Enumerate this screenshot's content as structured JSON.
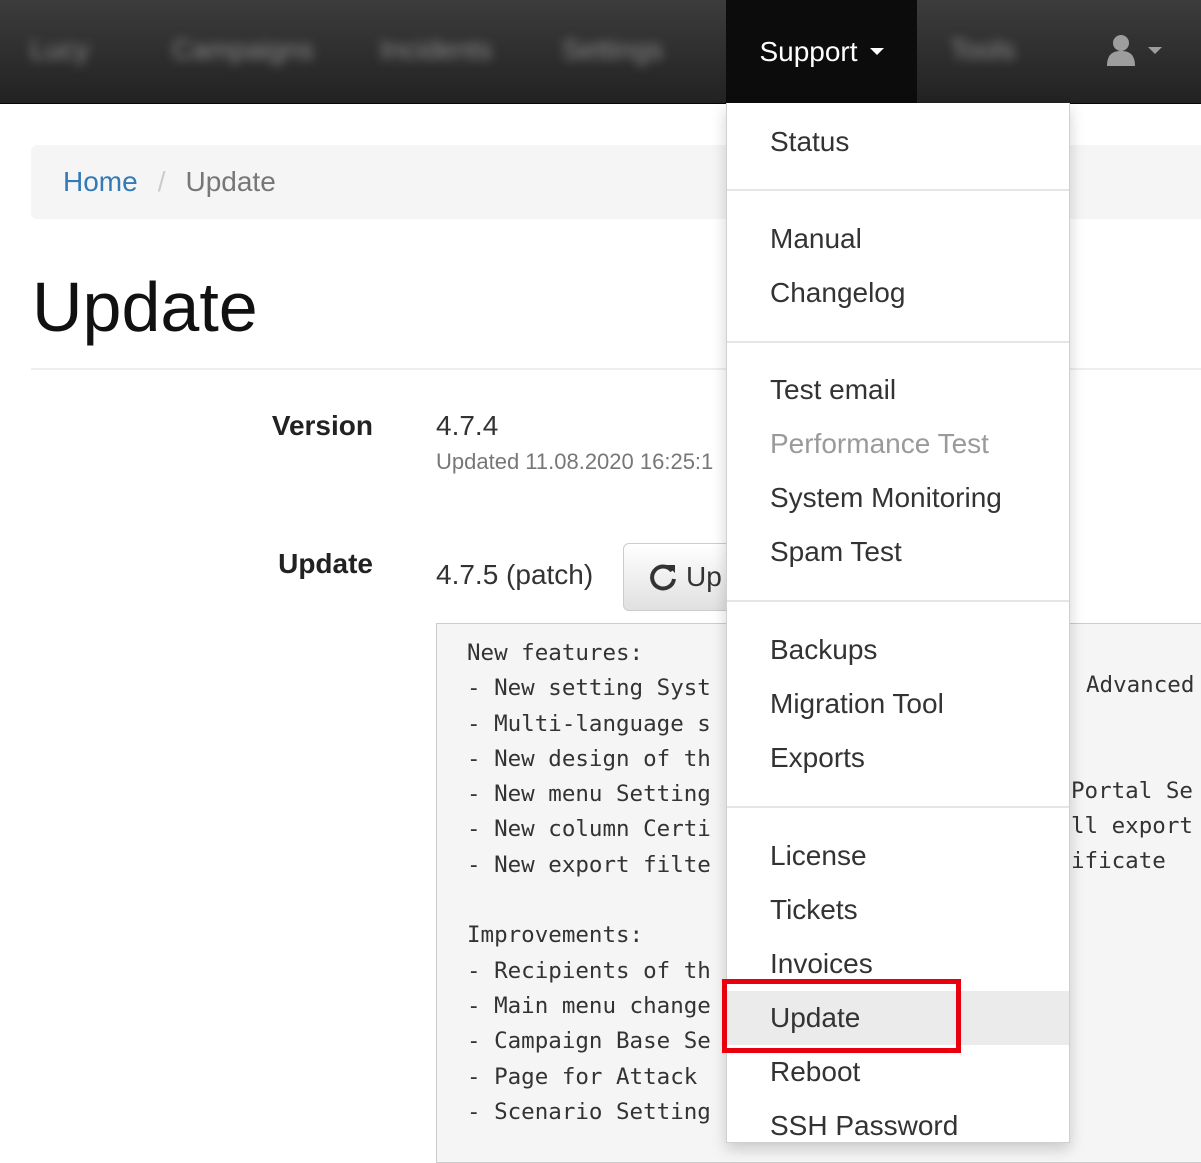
{
  "navbar": {
    "items_blurred": [
      "Lucy",
      "Campaigns",
      "Incidents",
      "Settings",
      "Tools"
    ],
    "support_label": "Support",
    "user_icon": "user-icon"
  },
  "breadcrumb": {
    "home": "Home",
    "separator": "/",
    "current": "Update"
  },
  "page": {
    "title": "Update"
  },
  "version_row": {
    "label": "Version",
    "value": "4.7.4",
    "updated_text": "Updated 11.08.2020 16:25:1"
  },
  "update_row": {
    "label": "Update",
    "value": "4.7.5 (patch)",
    "button_label": "Up",
    "button_icon": "refresh-icon"
  },
  "changelog": {
    "lines": [
      "New features:",
      "- New setting Syst",
      "- Multi-language s",
      "- New design of th",
      "- New menu Setting",
      "- New column Certi",
      "- New export filte",
      "",
      "Improvements:",
      "- Recipients of th",
      "- Main menu change",
      "- Campaign Base Se",
      "- Page for Attack",
      "- Scenario Setting"
    ],
    "right_fragments": [
      "Advanced",
      "Portal Se",
      "ll export",
      "ificate"
    ]
  },
  "dropdown": {
    "groups": [
      [
        {
          "label": "Status"
        }
      ],
      [
        {
          "label": "Manual"
        },
        {
          "label": "Changelog"
        }
      ],
      [
        {
          "label": "Test email"
        },
        {
          "label": "Performance Test",
          "disabled": true
        },
        {
          "label": "System Monitoring"
        },
        {
          "label": "Spam Test"
        }
      ],
      [
        {
          "label": "Backups"
        },
        {
          "label": "Migration Tool"
        },
        {
          "label": "Exports"
        }
      ],
      [
        {
          "label": "License"
        },
        {
          "label": "Tickets"
        },
        {
          "label": "Invoices"
        },
        {
          "label": "Update",
          "active": true
        },
        {
          "label": "Reboot"
        },
        {
          "label": "SSH Password"
        }
      ]
    ]
  },
  "colors": {
    "navbar": "#222222",
    "link": "#337ab7",
    "highlight": "#e8000e"
  }
}
